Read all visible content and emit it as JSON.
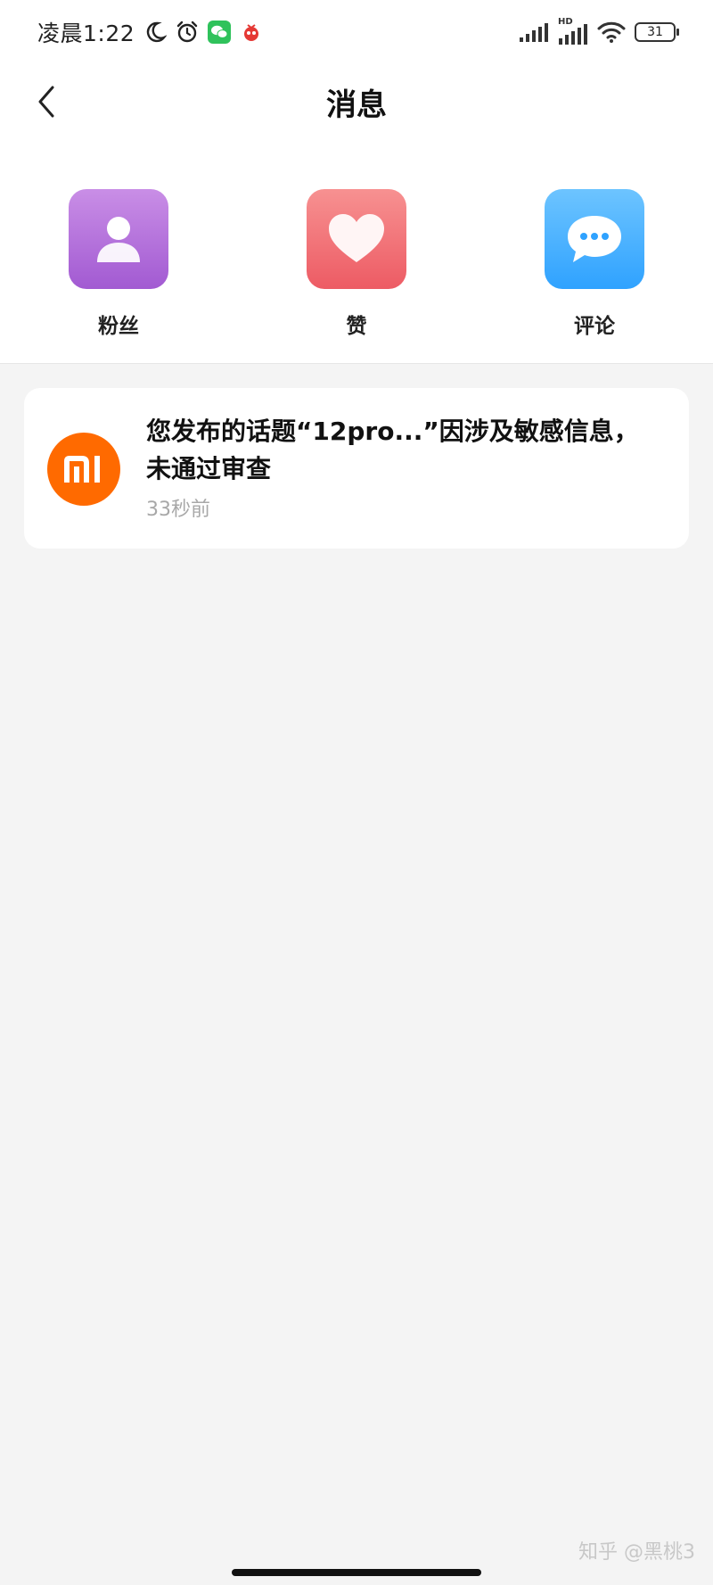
{
  "status_bar": {
    "time": "凌晨1:22",
    "battery": "31",
    "network_label": "HD"
  },
  "header": {
    "title": "消息"
  },
  "categories": [
    {
      "label": "粉丝",
      "icon": "person-icon",
      "color": "#a25ad2"
    },
    {
      "label": "赞",
      "icon": "heart-icon",
      "color": "#ed5b64"
    },
    {
      "label": "评论",
      "icon": "chat-bubble-icon",
      "color": "#2fa2ff"
    }
  ],
  "messages": [
    {
      "avatar_icon": "mi-logo-icon",
      "text": "您发布的话题“12pro...”因涉及敏感信息，未通过审查",
      "time": "33秒前"
    }
  ],
  "watermark": "知乎 @黑桃3",
  "colors": {
    "background": "#f4f4f4",
    "card": "#ffffff",
    "brand_orange": "#ff6a00"
  }
}
